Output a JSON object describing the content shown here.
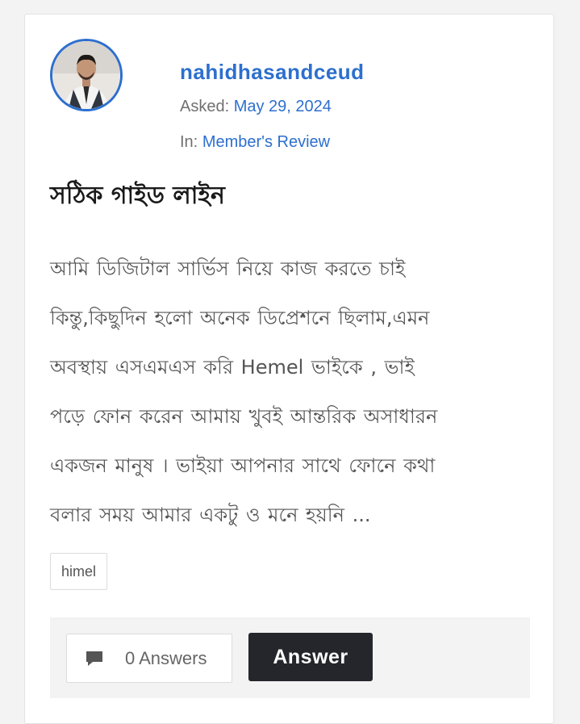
{
  "question": {
    "author": "nahidhasandceud",
    "asked_label": "Asked:",
    "asked_date": "May 29, 2024",
    "category_label": "In:",
    "category": "Member's Review",
    "title": "সঠিক গাইড লাইন",
    "excerpt_lines": [
      "আমি ডিজিটাল সার্ভিস নিয়ে কাজ করতে চাই",
      "কিন্তু,কিছুদিন হলো অনেক ডিপ্রেশনে ছিলাম,এমন",
      "অবস্থায় এসএমএস  করি Hemel ভাইকে , ভাই",
      "পড়ে ফোন করেন  আমায় খুবই আন্তরিক অসাধারন",
      "একজন মানুষ । ভাইয়া আপনার সাথে ফোনে কথা",
      "বলার সময় আমার একটু ও মনে হয়নি ..."
    ],
    "tag": "himel",
    "answers_count_label": "0 Answers",
    "answer_button": "Answer"
  },
  "icons": {
    "avatar": "user-photo",
    "comment": "comment-icon"
  },
  "colors": {
    "accent": "#2d6fcf",
    "button_bg": "#24262b",
    "text_muted": "#707070"
  }
}
